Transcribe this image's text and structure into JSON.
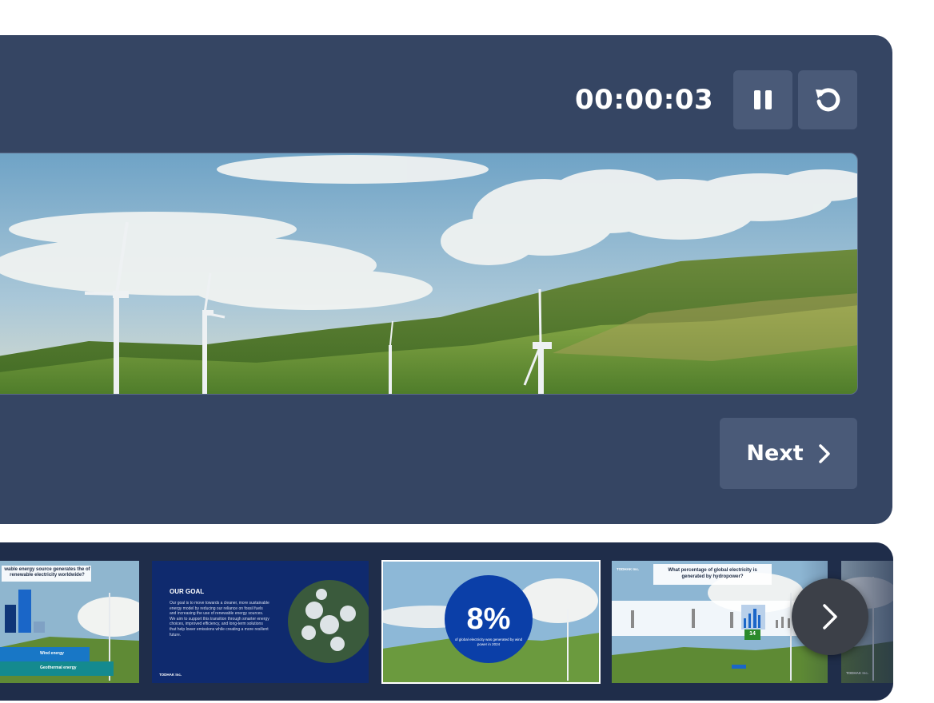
{
  "timer": {
    "value": "00:00:03"
  },
  "controls": {
    "pause_icon": "pause-icon",
    "restart_icon": "restart-icon"
  },
  "next_button": {
    "label": "Next",
    "icon": "chevron-right-icon"
  },
  "thumbnails": [
    {
      "question": "wable energy source generates the of renewable electricity worldwide?",
      "legend": [
        "Wind energy",
        "Geothermal energy"
      ]
    },
    {
      "title": "OUR GOAL",
      "body": "Our goal is to move towards a cleaner, more sustainable energy model by reducing our reliance on fossil fuels and increasing the use of renewable energy sources. We aim to support this transition through smarter energy choices, improved efficiency, and long-term solutions that help lower emissions while creating a more resilient future.",
      "brand": "TODHAK Inc."
    },
    {
      "stat": "8%",
      "caption": "of global electricity was generated by wind power in 2024"
    },
    {
      "brand": "TODHAK Inc.",
      "question": "What percentage of global electricity is generated by hydropower?",
      "selected_value": "14"
    },
    {
      "brand": "TODHAK Inc."
    }
  ],
  "colors": {
    "panel": "#354563",
    "button": "#4a5a78",
    "strip": "#1f2d4a",
    "stat_circle": "#0b3fa8",
    "goal_bg": "#0f2a6e"
  }
}
